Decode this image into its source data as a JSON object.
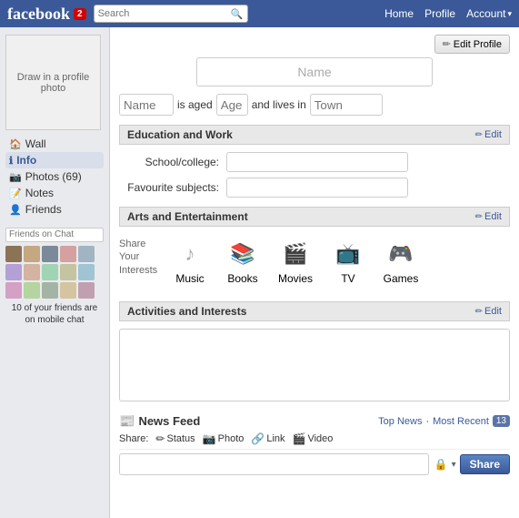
{
  "header": {
    "logo": "facebook",
    "notification_count": "2",
    "search_placeholder": "Search",
    "nav": {
      "home": "Home",
      "profile": "Profile",
      "account": "Account",
      "chevron": "▾"
    }
  },
  "sidebar": {
    "profile_photo_label": "Draw in a profile photo",
    "nav_items": [
      {
        "id": "wall",
        "label": "Wall",
        "icon": "🏠"
      },
      {
        "id": "info",
        "label": "Info",
        "icon": "ℹ️",
        "active": true
      },
      {
        "id": "photos",
        "label": "Photos (69)",
        "icon": "📷"
      },
      {
        "id": "notes",
        "label": "Notes",
        "icon": "📝"
      },
      {
        "id": "friends",
        "label": "Friends",
        "icon": "👤"
      }
    ],
    "friends_chat": {
      "search_placeholder": "Friends on Chat",
      "mobile_label": "10 of your friends are on mobile chat",
      "friend_count": 15
    }
  },
  "content": {
    "edit_profile_btn": "Edit Profile",
    "profile_name_placeholder": "Name",
    "profile_info": {
      "name_placeholder": "Name",
      "is_aged_label": "is aged",
      "age_placeholder": "Age",
      "and_lives_in_label": "and lives in",
      "town_placeholder": "Town"
    },
    "education_section": {
      "title": "Education and Work",
      "edit_label": "Edit",
      "fields": [
        {
          "label": "School/college:",
          "id": "school"
        },
        {
          "label": "Favourite subjects:",
          "id": "subjects"
        }
      ]
    },
    "arts_section": {
      "title": "Arts and Entertainment",
      "edit_label": "Edit",
      "share_label": "Share Your Interests",
      "interests": [
        {
          "id": "music",
          "label": "Music",
          "icon": "♪"
        },
        {
          "id": "books",
          "label": "Books",
          "icon": "📚"
        },
        {
          "id": "movies",
          "label": "Movies",
          "icon": "🎬"
        },
        {
          "id": "tv",
          "label": "TV",
          "icon": "📺"
        },
        {
          "id": "games",
          "label": "Games",
          "icon": "🎮"
        }
      ]
    },
    "activities_section": {
      "title": "Activities and Interests",
      "edit_label": "Edit"
    },
    "newsfeed": {
      "title": "News Feed",
      "newspaper_icon": "📰",
      "top_news": "Top News",
      "separator": "·",
      "most_recent": "Most Recent",
      "count": "13",
      "share_label": "Share:",
      "share_actions": [
        {
          "id": "status",
          "label": "Status",
          "icon": "✏"
        },
        {
          "id": "photo",
          "label": "Photo",
          "icon": "📷"
        },
        {
          "id": "link",
          "label": "Link",
          "icon": "🔗"
        },
        {
          "id": "video",
          "label": "Video",
          "icon": "🎬"
        }
      ],
      "post_placeholder": "",
      "share_btn": "Share",
      "lock_icon": "🔒"
    }
  }
}
